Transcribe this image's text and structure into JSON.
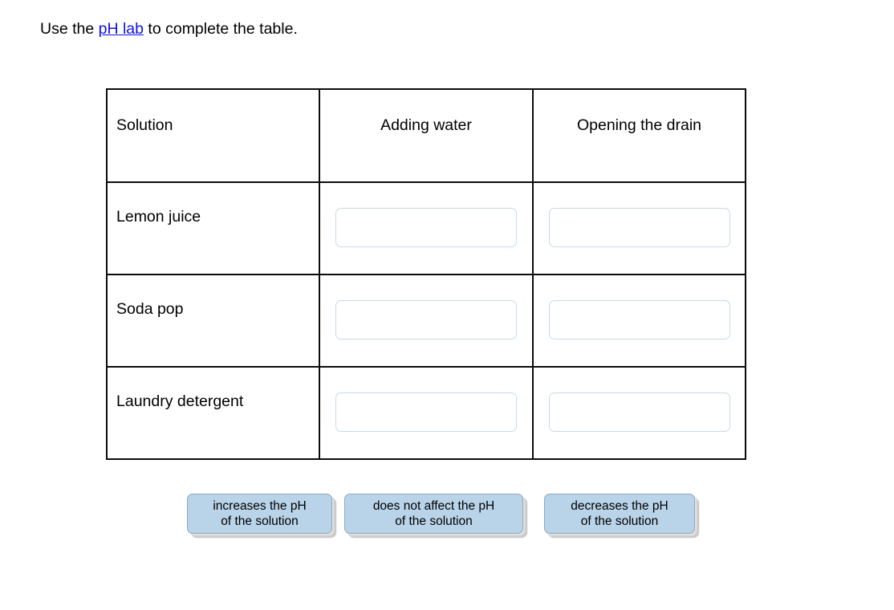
{
  "prompt": {
    "before": "Use the ",
    "link": "pH lab",
    "after": " to complete the table.",
    "link_color": "#1010ee"
  },
  "table": {
    "headers": [
      "Solution",
      "Adding water",
      "Opening the drain"
    ],
    "rows": [
      {
        "solution": "Lemon juice",
        "adding_water": "",
        "opening_the_drain": ""
      },
      {
        "solution": "Soda pop",
        "adding_water": "",
        "opening_the_drain": ""
      },
      {
        "solution": "Laundry detergent",
        "adding_water": "",
        "opening_the_drain": ""
      }
    ],
    "border_color": "#0c0c0c",
    "dropzone_border_color": "#c6daec"
  },
  "answer_tiles": [
    {
      "label": "increases the pH\nof the solution"
    },
    {
      "label": "does not affect the pH\nof the solution"
    },
    {
      "label": "decreases the pH\nof the solution"
    }
  ],
  "tile_style": {
    "fill": "#b9d4e9",
    "border": "#8fa9bd",
    "shadow": "#cfcfcf"
  }
}
